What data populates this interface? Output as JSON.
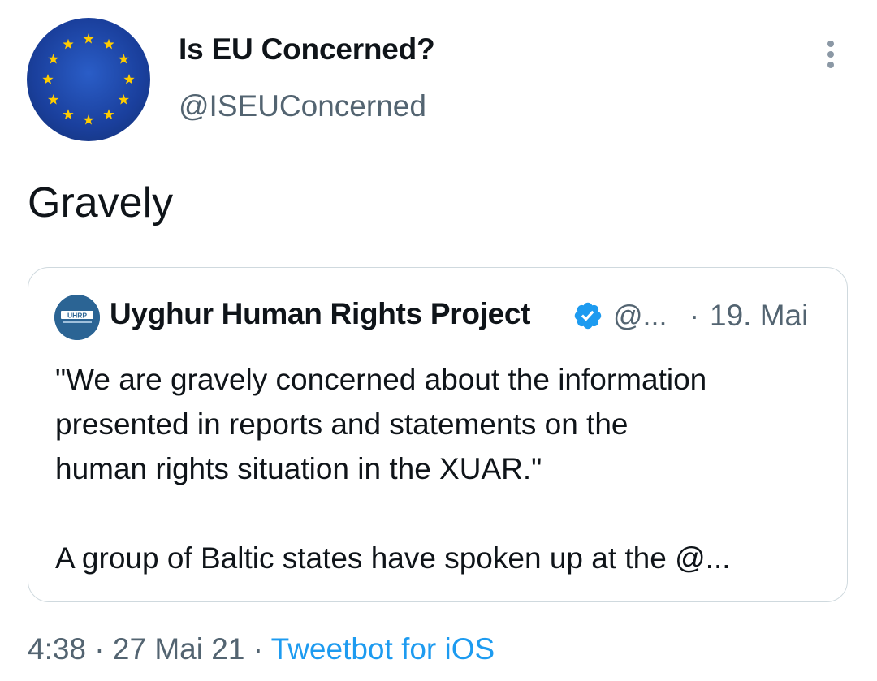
{
  "author": {
    "name": "Is EU Concerned?",
    "handle": "@ISEUConcerned",
    "avatar_icon": "eu-flag-avatar"
  },
  "more_icon": "more-vertical-icon",
  "tweet": {
    "text": "Gravely"
  },
  "quoted_tweet": {
    "author_name": "Uyghur Human Rights Project",
    "avatar_text": "UHRP",
    "verified_icon": "verified-badge-icon",
    "handle": "@...",
    "separator": "·",
    "date": "19. Mai",
    "body_line_1": "\"We are gravely concerned about the information",
    "body_line_2": "presented in reports and statements on the",
    "body_line_3": "human rights situation in the XUAR.\"",
    "body_line_4": "A group of Baltic states have spoken up at the @..."
  },
  "meta": {
    "time": "4:38",
    "sep1": "·",
    "date": "27 Mai 21",
    "sep2": "·",
    "source": "Tweetbot for iOS"
  },
  "colors": {
    "text_primary": "#0f1419",
    "text_secondary": "#536471",
    "link": "#1d9bf0",
    "border": "#cfd9de",
    "eu_blue": "#1a3f9c",
    "eu_star": "#ffcc00"
  }
}
